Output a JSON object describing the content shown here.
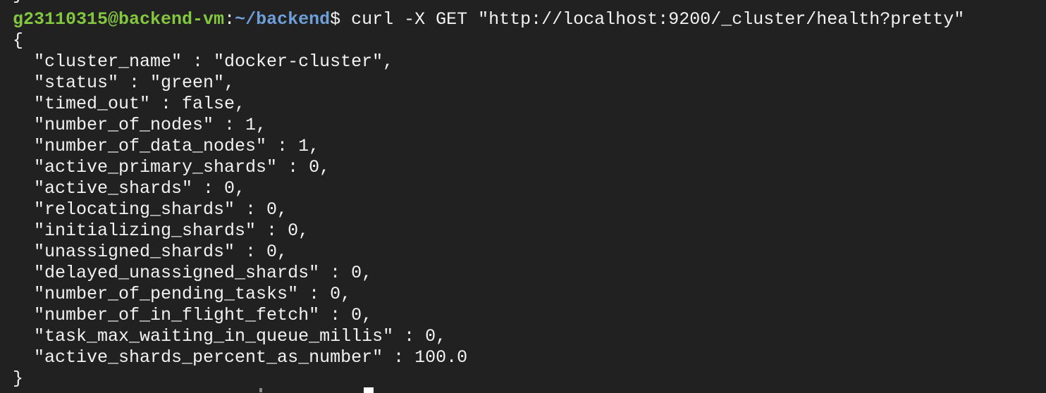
{
  "terminal": {
    "previous_line_tail": "}",
    "prompt": {
      "user_host": "g23110315@backend-vm",
      "separator": ":",
      "path": "~/backend",
      "symbol": "$ ",
      "command": "curl -X GET \"http://localhost:9200/_cluster/health?pretty\""
    },
    "open_brace": "{",
    "close_brace": "}",
    "output_lines": [
      "  \"cluster_name\" : \"docker-cluster\",",
      "  \"status\" : \"green\",",
      "  \"timed_out\" : false,",
      "  \"number_of_nodes\" : 1,",
      "  \"number_of_data_nodes\" : 1,",
      "  \"active_primary_shards\" : 0,",
      "  \"active_shards\" : 0,",
      "  \"relocating_shards\" : 0,",
      "  \"initializing_shards\" : 0,",
      "  \"unassigned_shards\" : 0,",
      "  \"delayed_unassigned_shards\" : 0,",
      "  \"number_of_pending_tasks\" : 0,",
      "  \"number_of_in_flight_fetch\" : 0,",
      "  \"task_max_waiting_in_queue_millis\" : 0,",
      "  \"active_shards_percent_as_number\" : 100.0"
    ],
    "colors": {
      "background": "#212121",
      "text": "#f2f2f2",
      "user_host": "#83c73f",
      "path": "#6e9fd9",
      "cursor": "#ffffff"
    }
  }
}
